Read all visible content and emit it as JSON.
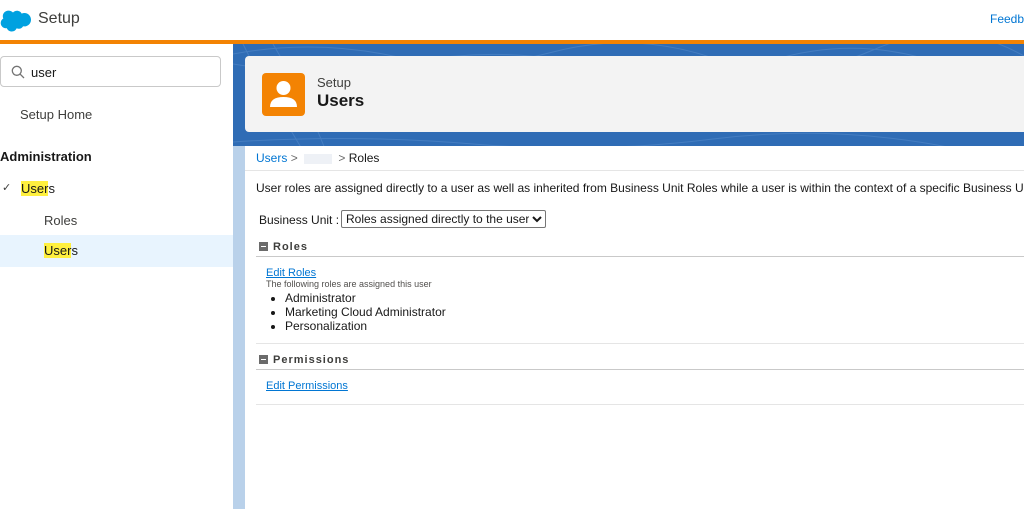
{
  "app": {
    "title": "Setup",
    "feedback_label": "Feedb"
  },
  "colors": {
    "accent": "#f38303",
    "brand_blue": "#0176d3",
    "highlight": "#fff03f"
  },
  "sidebar": {
    "search": {
      "value": "user",
      "icon": "search-icon"
    },
    "home_label": "Setup Home",
    "section_title": "Administration",
    "users_prefix": "User",
    "users_suffix": "s",
    "roles_label": "Roles",
    "users_sub_prefix": "User",
    "users_sub_suffix": "s"
  },
  "header": {
    "subtitle": "Setup",
    "title": "Users",
    "icon": "user-icon"
  },
  "breadcrumb": {
    "users": "Users",
    "sep1": ">",
    "sep2": ">",
    "current": "Roles"
  },
  "description": "User roles are assigned directly to a user as well as inherited from Business Unit Roles while a user is within the context of a specific Business Unit",
  "business_unit": {
    "label": "Business Unit :",
    "selected": "Roles assigned directly to the user"
  },
  "roles_section": {
    "title": "Roles",
    "edit_link": "Edit Roles",
    "help_text": "The following roles are assigned this user",
    "items": [
      "Administrator",
      "Marketing Cloud Administrator",
      "Personalization"
    ]
  },
  "permissions_section": {
    "title": "Permissions",
    "edit_link": "Edit Permissions"
  }
}
